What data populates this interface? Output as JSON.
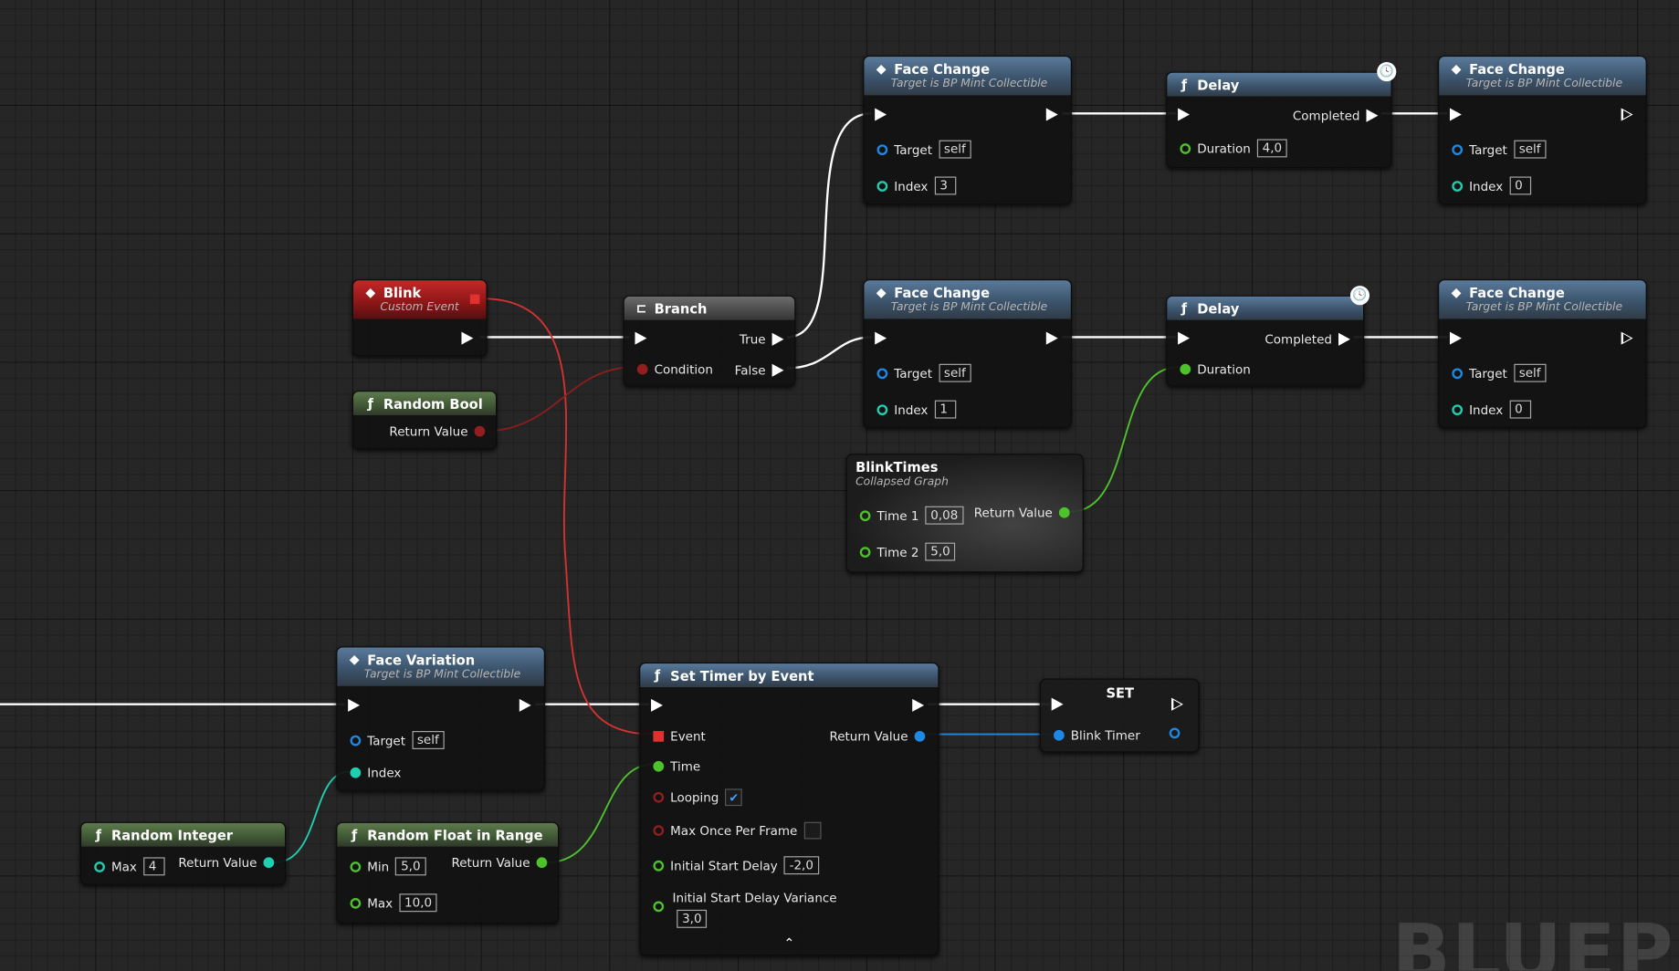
{
  "colors": {
    "exec": "#ffffff",
    "bool": "#921e1e",
    "object": "#1e88e5",
    "integer": "#1fd0b0",
    "float": "#4ec22a",
    "event_header": "#b32020",
    "function_header": "#3c546c",
    "pure_header": "#3f5734"
  },
  "icons": {
    "event": "diamond-icon",
    "function": "function-icon",
    "branch": "branch-icon",
    "latent": "clock-icon"
  },
  "nodes": {
    "blink": {
      "title": "Blink",
      "subtitle": "Custom Event"
    },
    "random_bool": {
      "title": "Random Bool",
      "return_label": "Return Value"
    },
    "branch": {
      "title": "Branch",
      "true_label": "True",
      "false_label": "False",
      "condition_label": "Condition"
    },
    "face_change_1": {
      "title": "Face Change",
      "subtitle": "Target is BP Mint Collectible",
      "target_label": "Target",
      "target_value": "self",
      "index_label": "Index",
      "index_value": "3"
    },
    "face_change_2": {
      "title": "Face Change",
      "subtitle": "Target is BP Mint Collectible",
      "target_label": "Target",
      "target_value": "self",
      "index_label": "Index",
      "index_value": "1"
    },
    "face_change_3": {
      "title": "Face Change",
      "subtitle": "Target is BP Mint Collectible",
      "target_label": "Target",
      "target_value": "self",
      "index_label": "Index",
      "index_value": "0"
    },
    "face_change_4": {
      "title": "Face Change",
      "subtitle": "Target is BP Mint Collectible",
      "target_label": "Target",
      "target_value": "self",
      "index_label": "Index",
      "index_value": "0"
    },
    "delay_1": {
      "title": "Delay",
      "completed_label": "Completed",
      "duration_label": "Duration",
      "duration_value": "4,0"
    },
    "delay_2": {
      "title": "Delay",
      "completed_label": "Completed",
      "duration_label": "Duration"
    },
    "blink_times": {
      "title": "BlinkTimes",
      "subtitle": "Collapsed Graph",
      "time1_label": "Time 1",
      "time1_value": "0,08",
      "time2_label": "Time 2",
      "time2_value": "5,0",
      "return_label": "Return Value"
    },
    "face_variation": {
      "title": "Face Variation",
      "subtitle": "Target is BP Mint Collectible",
      "target_label": "Target",
      "target_value": "self",
      "index_label": "Index"
    },
    "random_integer": {
      "title": "Random Integer",
      "max_label": "Max",
      "max_value": "4",
      "return_label": "Return Value"
    },
    "random_float": {
      "title": "Random Float in Range",
      "min_label": "Min",
      "min_value": "5,0",
      "max_label": "Max",
      "max_value": "10,0",
      "return_label": "Return Value"
    },
    "set_timer": {
      "title": "Set Timer by Event",
      "event_label": "Event",
      "return_label": "Return Value",
      "time_label": "Time",
      "looping_label": "Looping",
      "looping_checked": true,
      "max_once_label": "Max Once Per Frame",
      "max_once_checked": false,
      "initial_delay_label": "Initial Start Delay",
      "initial_delay_value": "-2,0",
      "variance_label": "Initial Start Delay Variance",
      "variance_value": "3,0"
    },
    "set_node": {
      "title": "SET",
      "var_label": "Blink Timer"
    }
  },
  "watermark": "BLUEPRIN"
}
